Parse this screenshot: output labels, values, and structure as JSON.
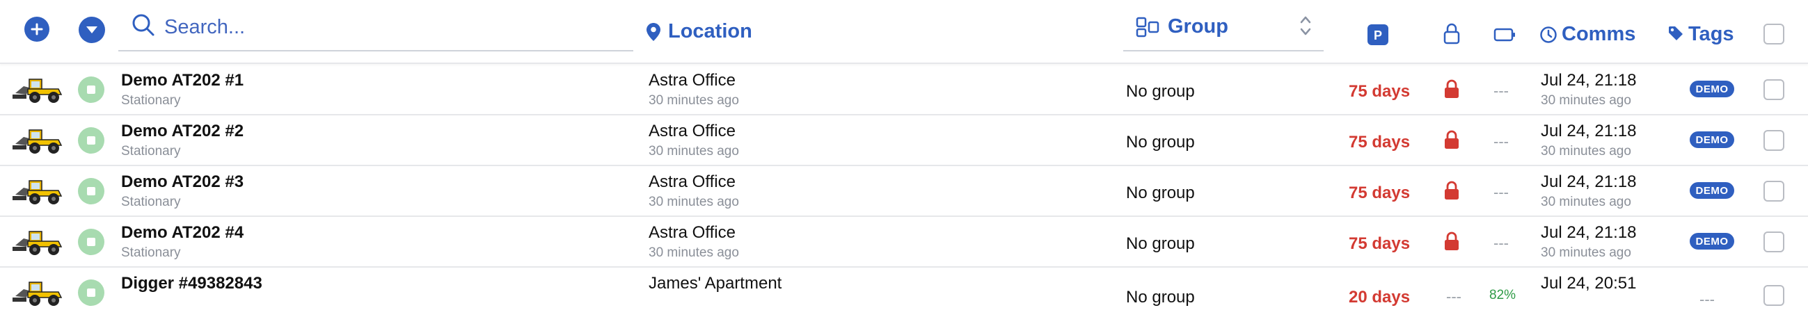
{
  "header": {
    "search_placeholder": "Search...",
    "location_label": "Location",
    "group_label": "Group",
    "comms_label": "Comms",
    "tags_label": "Tags"
  },
  "colors": {
    "accent": "#2f5fc0",
    "status_green": "#a8dbb0",
    "warning_red": "#d33a32",
    "battery_green": "#2e9b46"
  },
  "icons": {
    "add": "plus-circle-icon",
    "dropdown": "chevron-down-circle-icon",
    "search": "search-icon",
    "location": "map-pin-icon",
    "group": "group-icon",
    "sort": "sort-icon",
    "parking": "parking-icon",
    "lock": "lock-icon",
    "battery": "battery-icon",
    "clock": "clock-icon",
    "tag": "tag-icon",
    "vehicle": "wheel-loader-icon"
  },
  "rows": [
    {
      "name": "Demo AT202 #1",
      "state": "Stationary",
      "location": "Astra Office",
      "location_time": "30 minutes ago",
      "group": "No group",
      "days": "75 days",
      "locked": true,
      "battery": "---",
      "comms": "Jul 24, 21:18",
      "comms_time": "30 minutes ago",
      "tag": "DEMO"
    },
    {
      "name": "Demo AT202 #2",
      "state": "Stationary",
      "location": "Astra Office",
      "location_time": "30 minutes ago",
      "group": "No group",
      "days": "75 days",
      "locked": true,
      "battery": "---",
      "comms": "Jul 24, 21:18",
      "comms_time": "30 minutes ago",
      "tag": "DEMO"
    },
    {
      "name": "Demo AT202 #3",
      "state": "Stationary",
      "location": "Astra Office",
      "location_time": "30 minutes ago",
      "group": "No group",
      "days": "75 days",
      "locked": true,
      "battery": "---",
      "comms": "Jul 24, 21:18",
      "comms_time": "30 minutes ago",
      "tag": "DEMO"
    },
    {
      "name": "Demo AT202 #4",
      "state": "Stationary",
      "location": "Astra Office",
      "location_time": "30 minutes ago",
      "group": "No group",
      "days": "75 days",
      "locked": true,
      "battery": "---",
      "comms": "Jul 24, 21:18",
      "comms_time": "30 minutes ago",
      "tag": "DEMO"
    },
    {
      "name": "Digger #49382843",
      "state": "",
      "location": "James' Apartment",
      "location_time": "",
      "group": "No group",
      "days": "20 days",
      "lock": "---",
      "battery": "82%",
      "comms": "Jul 24, 20:51",
      "comms_time": "",
      "tag": "---"
    }
  ]
}
